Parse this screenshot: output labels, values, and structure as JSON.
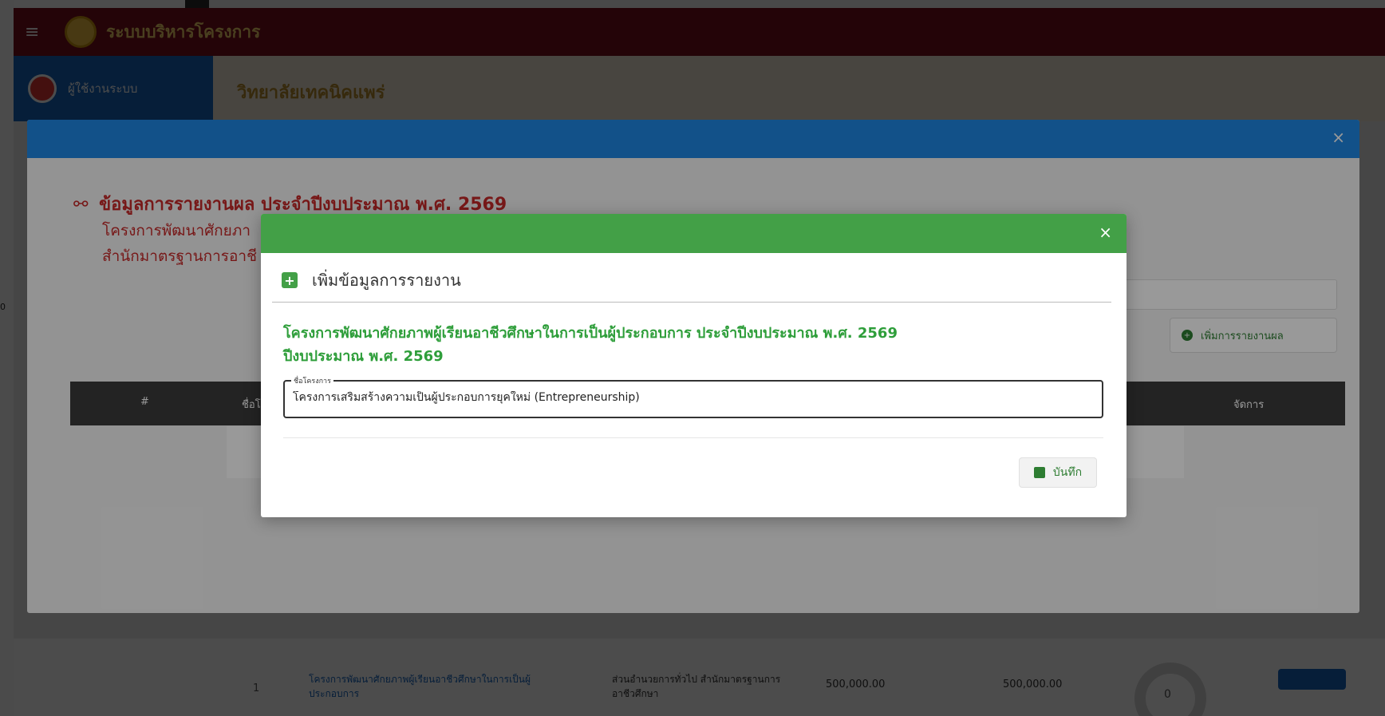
{
  "app": {
    "title": "ระบบบริหารโครงการ",
    "user_name": "ผู้ใช้งานระบบ",
    "org_name": "วิทยาลัยเทคนิคแพร่"
  },
  "background_row": {
    "number": "1",
    "project_link": "โครงการพัฒนาศักยภาพผู้เรียนอาชีวศึกษาในการเป็นผู้ประกอบการ",
    "department": "ส่วนอำนวยการทั่วไป สำนักมาตรฐานการอาชีวศึกษา",
    "amount_1": "500,000.00",
    "amount_2": "500,000.00",
    "progress_count": "0"
  },
  "edge_fragment": "0",
  "report_modal": {
    "title": "ข้อมูลการรายงานผล ประจำปีงบประมาณ พ.ศ. 2569",
    "subtitle_1": "โครงการพัฒนาศักยภา",
    "subtitle_2": "สำนักมาตรฐานการอาชี",
    "add_report_button": "เพิ่มการรายงานผล",
    "table_headers": {
      "number": "#",
      "name": "ชื่อโ",
      "manage": "จัดการ"
    },
    "close_symbol": "×"
  },
  "add_report_modal": {
    "title": "เพิ่มข้อมูลการรายงาน",
    "project_heading": "โครงการพัฒนาศักยภาพผู้เรียนอาชีวศึกษาในการเป็นผู้ประกอบการ ประจำปีงบประมาณ พ.ศ. 2569",
    "budget_year": "ปีงบประมาณ พ.ศ. 2569",
    "field_label": "ชื่อโครงการ",
    "field_value": "โครงการเสริมสร้างความเป็นผู้ประกอบการยุคใหม่ (Entrepreneurship)",
    "save_button": "บันทึก",
    "close_symbol": "×"
  },
  "icons": {
    "menu": "hamburger-icon",
    "project_tree": "sitemap-icon",
    "calendar_add": "calendar-plus-icon",
    "save": "floppy-disk-icon",
    "close": "close-icon"
  },
  "colors": {
    "topbar": "#7a0e1c",
    "primary_blue": "#1e88e5",
    "success_green": "#43a047",
    "heading_red": "#c62828",
    "heading_green": "#2e9e3a"
  }
}
